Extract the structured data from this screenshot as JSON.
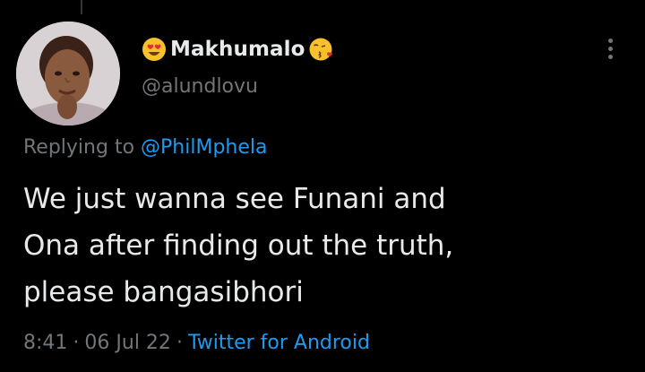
{
  "tweet": {
    "display_name": "Makhumalo",
    "handle": "@alundlovu",
    "name_prefix_icon": "heart-eyes-emoji",
    "name_suffix_icon": "kissing-heart-emoji",
    "reply_prefix": "Replying to",
    "reply_to": "@PhilMphela",
    "text_lines": [
      "We just wanna see Funani and",
      "Ona after finding out the truth,",
      "please bangasibhori"
    ],
    "time": "8:41",
    "date": "06 Jul 22",
    "separator": "·",
    "source": "Twitter for Android"
  },
  "icons": {
    "more": "more-vertical-icon"
  },
  "colors": {
    "background": "#000000",
    "primary_text": "#e7e9ea",
    "secondary_text": "#71767b",
    "link": "#1d9bf0"
  }
}
